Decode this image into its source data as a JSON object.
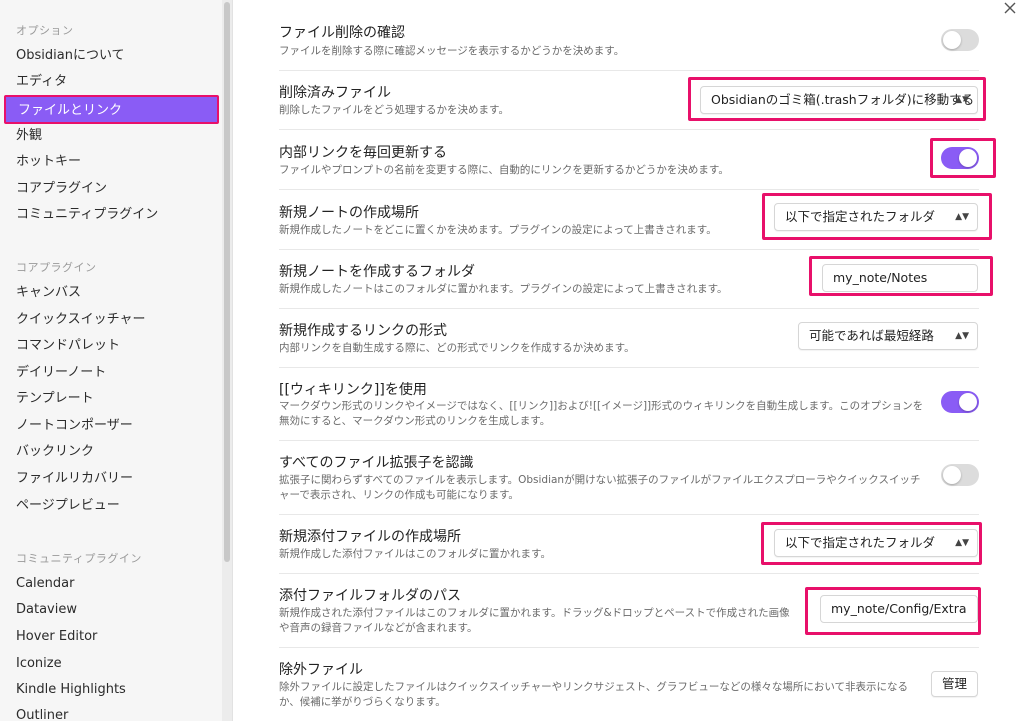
{
  "sidebar": {
    "sections": [
      {
        "header": "オプション",
        "items": [
          "Obsidianについて",
          "エディタ",
          "ファイルとリンク",
          "外観",
          "ホットキー",
          "コアプラグイン",
          "コミュニティプラグイン"
        ]
      },
      {
        "header": "コアプラグイン",
        "items": [
          "キャンバス",
          "クイックスイッチャー",
          "コマンドパレット",
          "デイリーノート",
          "テンプレート",
          "ノートコンポーザー",
          "バックリンク",
          "ファイルリカバリー",
          "ページプレビュー"
        ]
      },
      {
        "header": "コミュニティプラグイン",
        "items": [
          "Calendar",
          "Dataview",
          "Hover Editor",
          "Iconize",
          "Kindle Highlights",
          "Outliner"
        ]
      }
    ],
    "active_item": "ファイルとリンク"
  },
  "window": {
    "close_icon": "close-icon"
  },
  "settings": [
    {
      "name": "ファイル削除の確認",
      "desc": "ファイルを削除する際に確認メッセージを表示するかどうかを決めます。",
      "control": "toggle",
      "on": false
    },
    {
      "name": "削除済みファイル",
      "desc": "削除したファイルをどう処理するかを決めます。",
      "control": "dropdown",
      "value": "Obsidianのゴミ箱(.trashフォルダ)に移動する",
      "highlighted": true
    },
    {
      "name": "内部リンクを毎回更新する",
      "desc": "ファイルやプロンプトの名前を変更する際に、自動的にリンクを更新するかどうかを決めます。",
      "control": "toggle",
      "on": true,
      "highlighted": true
    },
    {
      "name": "新規ノートの作成場所",
      "desc": "新規作成したノートをどこに置くかを決めます。プラグインの設定によって上書きされます。",
      "control": "dropdown",
      "value": "以下で指定されたフォルダ",
      "highlighted": true
    },
    {
      "name": "新規ノートを作成するフォルダ",
      "desc": "新規作成したノートはこのフォルダに置かれます。プラグインの設定によって上書きされます。",
      "control": "text",
      "value": "my_note/Notes",
      "highlighted": true
    },
    {
      "name": "新規作成するリンクの形式",
      "desc": "内部リンクを自動生成する際に、どの形式でリンクを作成するか決めます。",
      "control": "dropdown",
      "value": "可能であれば最短経路"
    },
    {
      "name": "[[ウィキリンク]]を使用",
      "desc": "マークダウン形式のリンクやイメージではなく、[[リンク]]および![[イメージ]]形式のウィキリンクを自動生成します。このオプションを無効にすると、マークダウン形式のリンクを生成します。",
      "control": "toggle",
      "on": true
    },
    {
      "name": "すべてのファイル拡張子を認識",
      "desc": "拡張子に関わらずすべてのファイルを表示します。Obsidianが開けない拡張子のファイルがファイルエクスプローラやクイックスイッチャーで表示され、リンクの作成も可能になります。",
      "control": "toggle",
      "on": false
    },
    {
      "name": "新規添付ファイルの作成場所",
      "desc": "新規作成した添付ファイルはこのフォルダに置かれます。",
      "control": "dropdown",
      "value": "以下で指定されたフォルダ",
      "highlighted": true
    },
    {
      "name": "添付ファイルフォルダのパス",
      "desc": "新規作成された添付ファイルはこのフォルダに置かれます。ドラッグ&ドロップとペーストで作成された画像や音声の録音ファイルなどが含まれます。",
      "control": "text",
      "value": "my_note/Config/Extra",
      "highlighted": true
    },
    {
      "name": "除外ファイル",
      "desc": "除外ファイルに設定したファイルはクイックスイッチャーやリンクサジェスト、グラフビューなどの様々な場所において非表示になるか、候補に挙がりづらくなります。",
      "control": "button",
      "value": "管理"
    }
  ],
  "colors": {
    "accent": "#8a5cf5",
    "highlight": "#e8106a"
  }
}
